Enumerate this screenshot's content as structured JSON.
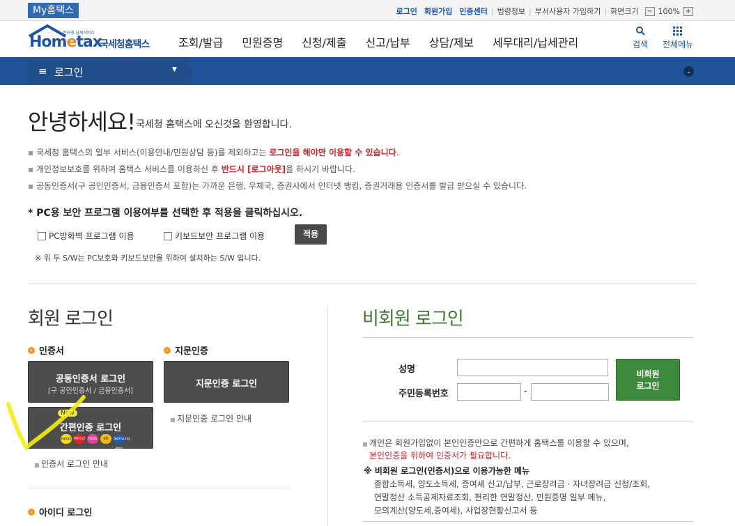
{
  "topbar": {
    "myhometax": "My홈택스",
    "login": "로그인",
    "signup": "회원가입",
    "cert_center": "인증센터",
    "law_info": "법령정보",
    "dept_signup": "부서사용자 가입하기",
    "zoom_label": "화면크기",
    "zoom_minus": "−",
    "zoom_value": "100%",
    "zoom_plus": "+"
  },
  "header": {
    "logo_main": "Hom",
    "logo_e": "e",
    "logo_tail": "tax",
    "logo_sub": "인터넷 납세서비스",
    "logo_kr": "국세청홈택스",
    "nav": [
      "조회/발급",
      "민원증명",
      "신청/제출",
      "신고/납부",
      "상담/제보",
      "세무대리/납세관리"
    ],
    "search_label": "검색",
    "allmenu_label": "전체메뉴"
  },
  "location": {
    "menu_icon": "≡",
    "label": "로그인"
  },
  "greeting": {
    "title": "안녕하세요!",
    "subtitle": "국세청 홈택스에 오신것을 환영합니다."
  },
  "notices": [
    {
      "pre": "국세청 홈택스의 일부 서비스(이용안내/민원상담 등)를 제외하고는 ",
      "red": "로그인을 해야만 이용할 수 있습니다",
      "post": "."
    },
    {
      "pre": "개인정보보호를 위하여 홈택스 서비스를 이용하신 후 ",
      "red": "반드시 [로그아웃]",
      "post": "을 하시기 바랍니다."
    },
    {
      "pre": "공동인증서(구 공인인증서, 금융인증서 포함)는 가까운 은행, 우체국, 증권사에서 인터넷 뱅킹, 증권거래용 인증서를 발급 받으실 수 있습니다.",
      "red": "",
      "post": ""
    }
  ],
  "pc_security": {
    "title": "* PC용 보안 프로그램 이용여부를 선택한 후 적용을 클릭하십시오.",
    "firewall_label": "PC방화벽 프로그램 이용",
    "keyboard_label": "키보드보안 프로그램 이용",
    "apply_label": "적용",
    "note": "※ 위 두 S/W는 PC보호와 키보드보안을 위하여 설치하는 S/W 입니다."
  },
  "member": {
    "title": "회원 로그인",
    "cert_head": "인증서",
    "finger_head": "지문인증",
    "joint_cert_title": "공동인증서 로그인",
    "joint_cert_sub": "[구 공인인증서 / 금융인증서]",
    "finger_btn": "지문인증 로그인",
    "new_badge": "New",
    "simple_cert_title": "간편인증 로그인",
    "finger_guide": "지문인증 로그인 안내",
    "cert_guide": "인증서 로그인 안내",
    "id_head": "아이디 로그인",
    "coins": [
      {
        "label": "kakao",
        "color": "#f5d90a"
      },
      {
        "label": "PAYCO",
        "color": "#e8202a"
      },
      {
        "label": "PASS",
        "color": "#e54095"
      },
      {
        "label": "KB",
        "color": "#f0b912"
      },
      {
        "label": "Samsung Pass",
        "color": "#1f5bb0"
      }
    ]
  },
  "nonmember": {
    "title": "비회원 로그인",
    "name_label": "성명",
    "rrn_label": "주민등록번호",
    "dash": "-",
    "login_btn_line1": "비회원",
    "login_btn_line2": "로그인",
    "info1": "개인은 회원가입없이 본인인증만으로 간편하게 홈택스를 이용할 수 있으며,",
    "info2": "본인인증을 위하여 인증서가 필요합니다.",
    "menu_head": "※ 비회원 로그인(인증서)으로 이용가능한 메뉴",
    "menu_lines": [
      "종합소득세, 양도소득세, 증여세 신고/납부, 근로장려금 · 자녀장려금 신청/조회,",
      "연말정산 소득공제자료조회, 편리한 연말정산, 민원증명 일부 메뉴,",
      "모의계산(양도세,증여세), 사업장현황신고서 등"
    ]
  }
}
